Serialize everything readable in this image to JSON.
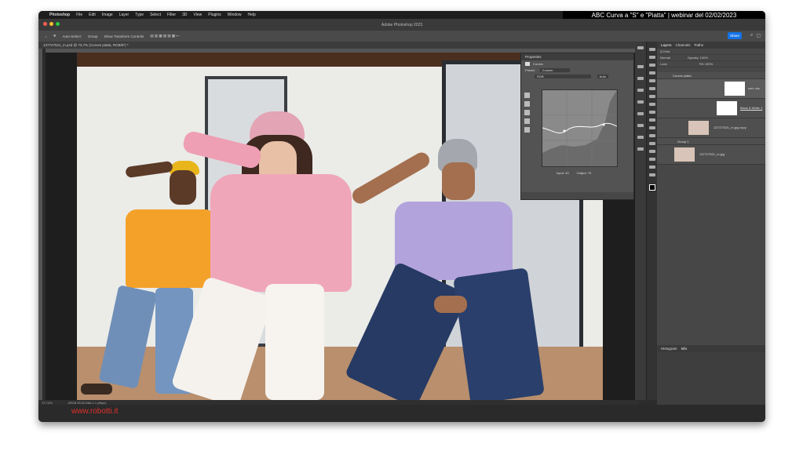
{
  "menubar": {
    "app": "Photoshop",
    "items": [
      "File",
      "Edit",
      "Image",
      "Layer",
      "Type",
      "Select",
      "Filter",
      "3D",
      "View",
      "Plugins",
      "Window",
      "Help"
    ]
  },
  "banner": {
    "text": "ABC Curva a \"S\" e \"Piatta\" | webinar del 02/02/2023"
  },
  "window": {
    "title": "Adobe Photoshop 2023"
  },
  "options": {
    "auto_select": "Auto-Select:",
    "group": "Group",
    "transform": "Show Transform Controls",
    "share": "Share"
  },
  "document": {
    "tab": "137727521_m.psd @ 72,7% (Curves piatta, RGB/8*) *"
  },
  "properties": {
    "title": "Properties",
    "curves": "Curves",
    "preset_label": "Preset:",
    "preset": "Custom",
    "channel": "RGB",
    "auto": "Auto",
    "input": "Input: 43",
    "output": "Output: 79"
  },
  "layers": {
    "tabs": [
      "Layers",
      "Channels",
      "Paths"
    ],
    "kind": "Q Kind",
    "blend": "Normal",
    "opacity": "Opacity: 100%",
    "lock": "Lock:",
    "fill": "Fill: 100%",
    "items": [
      {
        "name": "Curves piatta"
      },
      {
        "name": "curv..via"
      },
      {
        "name": "Black & White 1"
      },
      {
        "name": "137727521_m.jpg copy"
      },
      {
        "name": "Group 1"
      },
      {
        "name": "137727521_m.jpg"
      }
    ]
  },
  "info": {
    "tabs": [
      "Histogram",
      "Info"
    ]
  },
  "status": {
    "zoom": "72,74%",
    "profile": "sRGB IEC61966-2.1 (8bpc)"
  },
  "credit": {
    "text": "www.robotti.it"
  },
  "colors": {
    "accent": "#1473e6",
    "credit": "#e0312a"
  }
}
